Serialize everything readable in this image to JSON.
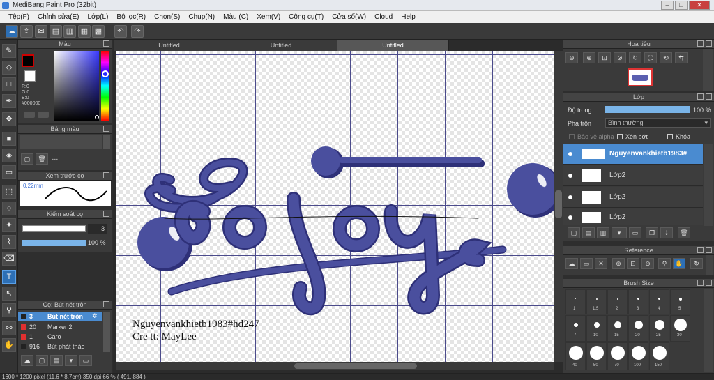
{
  "app": {
    "title": "MediBang Paint Pro (32bit)"
  },
  "window_buttons": {
    "minimize": "‒",
    "maximize": "□",
    "close": "✕"
  },
  "menu": [
    "Tệp(F)",
    "Chỉnh sửa(E)",
    "Lớp(L)",
    "Bộ lọc(R)",
    "Chọn(S)",
    "Chụp(N)",
    "Màu (C)",
    "Xem(V)",
    "Công cụ(T)",
    "Cửa sổ(W)",
    "Cloud",
    "Help"
  ],
  "tabs": [
    "Untitled",
    "Untitled",
    "Untitled"
  ],
  "color_panel": {
    "title": "Màu",
    "r": "R:0",
    "g": "G:0",
    "b": "B:0",
    "hex": "#000000",
    "primary": "#000000",
    "secondary": "#ffffff"
  },
  "palette_panel": {
    "title": "Bảng màu",
    "dash": "---"
  },
  "preview_panel": {
    "title": "Xem trước cọ",
    "size": "0.22mm"
  },
  "brush_control": {
    "title": "Kiểm soát cọ",
    "size": "3",
    "opacity": "100 %"
  },
  "brush_list": {
    "title": "Cọ: Bút nét tròn",
    "items": [
      {
        "size": "3",
        "name": "Bút nét tròn",
        "color": "#222222"
      },
      {
        "size": "20",
        "name": "Marker 2",
        "color": "#e03030"
      },
      {
        "size": "1",
        "name": "Caro",
        "color": "#e03030"
      },
      {
        "size": "916",
        "name": "Bút phát thảo",
        "color": "#222222"
      }
    ]
  },
  "canvas_text": {
    "line1": "Nguyenvankhietb1983#hd247",
    "line2": "Cre tt: MayLee"
  },
  "navigator": {
    "title": "Hoa tiêu"
  },
  "layer_panel": {
    "title": "Lớp",
    "opacity_label": "Độ trong",
    "opacity_value": "100 %",
    "blend_label": "Pha trộn",
    "blend_value": "Bình thường",
    "protect_alpha": "Bảo vệ alpha",
    "clipping": "Xén bớt",
    "lock": "Khóa",
    "layers": [
      "Nguyenvankhietb1983#",
      "Lớp2",
      "Lớp2",
      "Lớp2"
    ]
  },
  "reference": {
    "title": "Reference"
  },
  "brush_size": {
    "title": "Brush Size",
    "labels": [
      "1",
      "1.5",
      "2",
      "3",
      "4",
      "5",
      "7",
      "10",
      "15",
      "20",
      "25",
      "30",
      "40",
      "50",
      "70",
      "100",
      "150"
    ]
  },
  "status": {
    "text": "1600 * 1200 pixel   (11.6 * 8.7cm)  350 dpi   66 %   ( 491, 884 )"
  },
  "colors": {
    "accent": "#4a8bd0",
    "lettering": "#4a4f9e",
    "grid": "#2f2f7a"
  }
}
